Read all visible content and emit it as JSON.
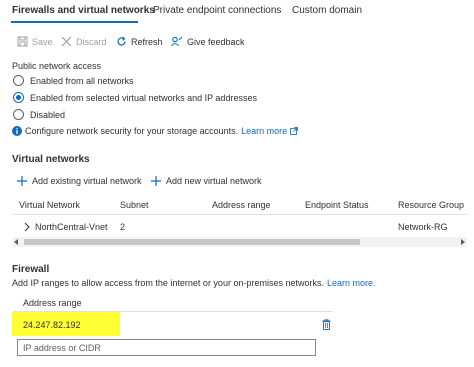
{
  "tabs": [
    {
      "label": "Firewalls and virtual networks"
    },
    {
      "label": "Private endpoint connections"
    },
    {
      "label": "Custom domain"
    }
  ],
  "toolbar": {
    "save_label": "Save",
    "discard_label": "Discard",
    "refresh_label": "Refresh",
    "feedback_label": "Give feedback"
  },
  "public_access": {
    "title": "Public network access",
    "options": [
      {
        "label": "Enabled from all networks",
        "selected": false
      },
      {
        "label": "Enabled from selected virtual networks and IP addresses",
        "selected": true
      },
      {
        "label": "Disabled",
        "selected": false
      }
    ],
    "info_text": "Configure network security for your storage accounts.",
    "learn_more": "Learn more"
  },
  "virtual_networks": {
    "title": "Virtual networks",
    "add_existing_label": "Add existing virtual network",
    "add_new_label": "Add new virtual network",
    "columns": [
      "Virtual Network",
      "Subnet",
      "Address range",
      "Endpoint Status",
      "Resource Group"
    ],
    "rows": [
      {
        "name": "NorthCentral-Vnet",
        "subnet": "2",
        "address_range": "",
        "endpoint_status": "",
        "resource_group": "Network-RG"
      }
    ]
  },
  "firewall": {
    "title": "Firewall",
    "description": "Add IP ranges to allow access from the internet or your on-premises networks.",
    "learn_more": "Learn more.",
    "address_range_header": "Address range",
    "entries": [
      "24.247.82.192"
    ],
    "input_placeholder": "IP address or CIDR",
    "input_value": ""
  },
  "colors": {
    "accent": "#0f6cbd",
    "highlight": "#ffff33",
    "text": "#323130",
    "disabled": "#a19f9d"
  }
}
